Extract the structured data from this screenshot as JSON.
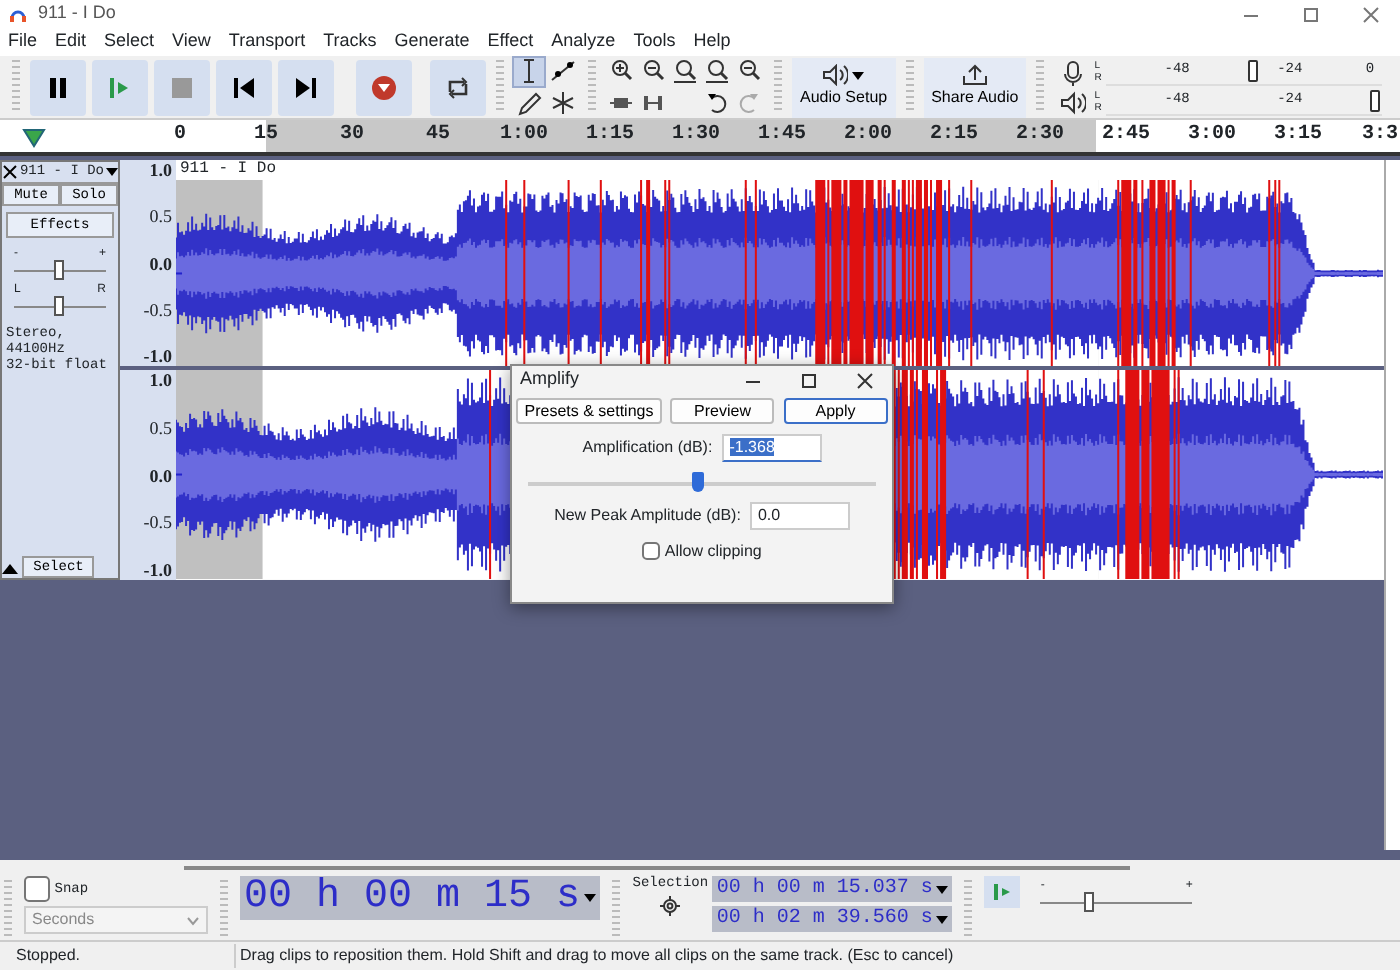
{
  "window": {
    "title": "911 - I Do"
  },
  "menu": [
    "File",
    "Edit",
    "Select",
    "View",
    "Transport",
    "Tracks",
    "Generate",
    "Effect",
    "Analyze",
    "Tools",
    "Help"
  ],
  "tools": [
    {
      "selected": true
    },
    {
      "selected": false
    },
    {
      "selected": false
    },
    {
      "selected": false
    }
  ],
  "audio_setup": {
    "label": "Audio Setup"
  },
  "share_audio": {
    "label": "Share Audio"
  },
  "meters": [
    {
      "kind": "record",
      "channels": [
        "L",
        "R"
      ],
      "scale": [
        "-48",
        "-24",
        "0"
      ],
      "level": 0.54
    },
    {
      "kind": "playback",
      "channels": [
        "L",
        "R"
      ],
      "scale": [
        "-48",
        "-24"
      ],
      "level": 1.0
    }
  ],
  "ruler": {
    "ticks": [
      "0",
      "15",
      "30",
      "45",
      "1:00",
      "1:15",
      "1:30",
      "1:45",
      "2:00",
      "2:15",
      "2:30",
      "2:45",
      "3:00",
      "3:15",
      "3:3"
    ]
  },
  "track": {
    "name": "911 - I Do",
    "mute": "Mute",
    "solo": "Solo",
    "effects": "Effects",
    "gain": {
      "min": "-",
      "max": "+",
      "level": 0.5
    },
    "pan": {
      "min": "L",
      "max": "R",
      "level": 0.5
    },
    "info": [
      "Stereo, 44100Hz",
      "32-bit float"
    ],
    "select": "Select",
    "clip_name": "911 - I Do",
    "channels": [
      {
        "scale": [
          "1.0",
          "0.5",
          "0.0",
          "-0.5",
          "-1.0"
        ]
      },
      {
        "scale": [
          "1.0",
          "0.5",
          "0.0",
          "-0.5",
          "-1.0"
        ]
      }
    ]
  },
  "dialog": {
    "title": "Amplify",
    "buttons": [
      {
        "label": "Presets & settings",
        "default": false
      },
      {
        "label": "Preview",
        "default": false
      },
      {
        "label": "Apply",
        "default": true
      }
    ],
    "amplification": {
      "label": "Amplification (dB):",
      "value": "-1.368"
    },
    "slider": {
      "level": 0.49
    },
    "new_peak": {
      "label": "New Peak Amplitude (dB):",
      "value": "0.0"
    },
    "allow_clipping": {
      "label": "Allow clipping",
      "checked": false
    }
  },
  "bottom": {
    "snap": {
      "label": "Snap",
      "checked": false
    },
    "snap_unit": "Seconds",
    "time": "00 h 00 m 15 s",
    "selection_label": "Selection",
    "selection_start": "00 h 00 m 15.037 s",
    "selection_end": "00 h 02 m 39.560 s",
    "speed": {
      "min": "-",
      "max": "+",
      "level": 0.33
    }
  },
  "status_bar": {
    "state": "Stopped.",
    "message": "Drag clips to reposition them. Hold Shift and drag to move all clips on the same track. (Esc to cancel)"
  }
}
